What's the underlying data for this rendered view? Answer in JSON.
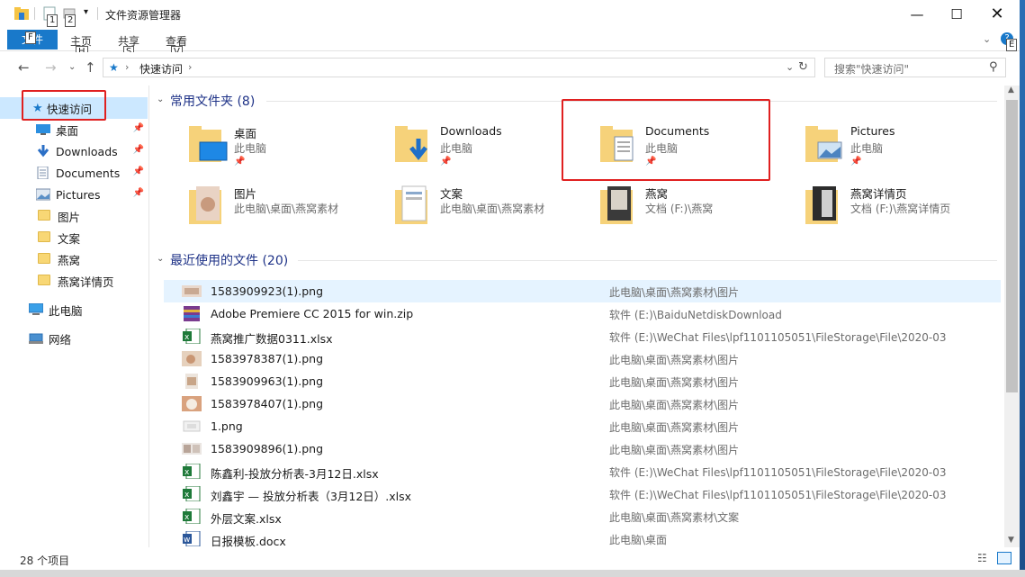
{
  "window": {
    "title": "文件资源管理器",
    "quick_access_keytips": [
      "1",
      "2"
    ]
  },
  "ribbon": {
    "file_tab": "文件",
    "file_keytip": "F",
    "tabs": [
      {
        "label": "主页",
        "keytip": "H"
      },
      {
        "label": "共享",
        "keytip": "S"
      },
      {
        "label": "查看",
        "keytip": "V"
      }
    ],
    "help_keytip": "E"
  },
  "address": {
    "crumb": "快速访问",
    "search_placeholder": "搜索\"快速访问\""
  },
  "sidebar": {
    "quick_access": "快速访问",
    "items": [
      {
        "label": "桌面",
        "icon": "desktop-icon",
        "pinned": true
      },
      {
        "label": "Downloads",
        "icon": "download-icon",
        "pinned": true
      },
      {
        "label": "Documents",
        "icon": "documents-icon",
        "pinned": true
      },
      {
        "label": "Pictures",
        "icon": "pictures-icon",
        "pinned": true
      },
      {
        "label": "图片",
        "icon": "folder-icon",
        "pinned": false
      },
      {
        "label": "文案",
        "icon": "folder-icon",
        "pinned": false
      },
      {
        "label": "燕窝",
        "icon": "folder-icon",
        "pinned": false
      },
      {
        "label": "燕窝详情页",
        "icon": "folder-icon",
        "pinned": false
      }
    ],
    "this_pc": "此电脑",
    "network": "网络"
  },
  "frequent": {
    "heading": "常用文件夹 (8)",
    "folders": [
      {
        "name": "桌面",
        "path": "此电脑",
        "pinned": true
      },
      {
        "name": "Downloads",
        "path": "此电脑",
        "pinned": true
      },
      {
        "name": "Documents",
        "path": "此电脑",
        "pinned": true
      },
      {
        "name": "Pictures",
        "path": "此电脑",
        "pinned": true
      },
      {
        "name": "图片",
        "path": "此电脑\\桌面\\燕窝素材",
        "pinned": false
      },
      {
        "name": "文案",
        "path": "此电脑\\桌面\\燕窝素材",
        "pinned": false
      },
      {
        "name": "燕窝",
        "path": "文档 (F:)\\燕窝",
        "pinned": false
      },
      {
        "name": "燕窝详情页",
        "path": "文档 (F:)\\燕窝详情页",
        "pinned": false
      }
    ]
  },
  "recent": {
    "heading": "最近使用的文件 (20)",
    "files": [
      {
        "name": "1583909923(1).png",
        "path": "此电脑\\桌面\\燕窝素材\\图片",
        "type": "image"
      },
      {
        "name": "Adobe Premiere CC 2015 for win.zip",
        "path": "软件 (E:)\\BaiduNetdiskDownload",
        "type": "zip"
      },
      {
        "name": "燕窝推广数据0311.xlsx",
        "path": "软件 (E:)\\WeChat Files\\lpf1101105051\\FileStorage\\File\\2020-03",
        "type": "xlsx"
      },
      {
        "name": "1583978387(1).png",
        "path": "此电脑\\桌面\\燕窝素材\\图片",
        "type": "image"
      },
      {
        "name": "1583909963(1).png",
        "path": "此电脑\\桌面\\燕窝素材\\图片",
        "type": "image"
      },
      {
        "name": "1583978407(1).png",
        "path": "此电脑\\桌面\\燕窝素材\\图片",
        "type": "image"
      },
      {
        "name": "1.png",
        "path": "此电脑\\桌面\\燕窝素材\\图片",
        "type": "image"
      },
      {
        "name": "1583909896(1).png",
        "path": "此电脑\\桌面\\燕窝素材\\图片",
        "type": "image"
      },
      {
        "name": "陈鑫利-投放分析表-3月12日.xlsx",
        "path": "软件 (E:)\\WeChat Files\\lpf1101105051\\FileStorage\\File\\2020-03",
        "type": "xlsx"
      },
      {
        "name": "刘鑫宇 — 投放分析表（3月12日）.xlsx",
        "path": "软件 (E:)\\WeChat Files\\lpf1101105051\\FileStorage\\File\\2020-03",
        "type": "xlsx"
      },
      {
        "name": "外层文案.xlsx",
        "path": "此电脑\\桌面\\燕窝素材\\文案",
        "type": "xlsx"
      },
      {
        "name": "日报模板.docx",
        "path": "此电脑\\桌面",
        "type": "docx"
      }
    ]
  },
  "status": {
    "count": "28 个项目"
  },
  "colors": {
    "accent": "#1979ca",
    "highlight": "#e02020",
    "group_heading": "#1e3287"
  }
}
